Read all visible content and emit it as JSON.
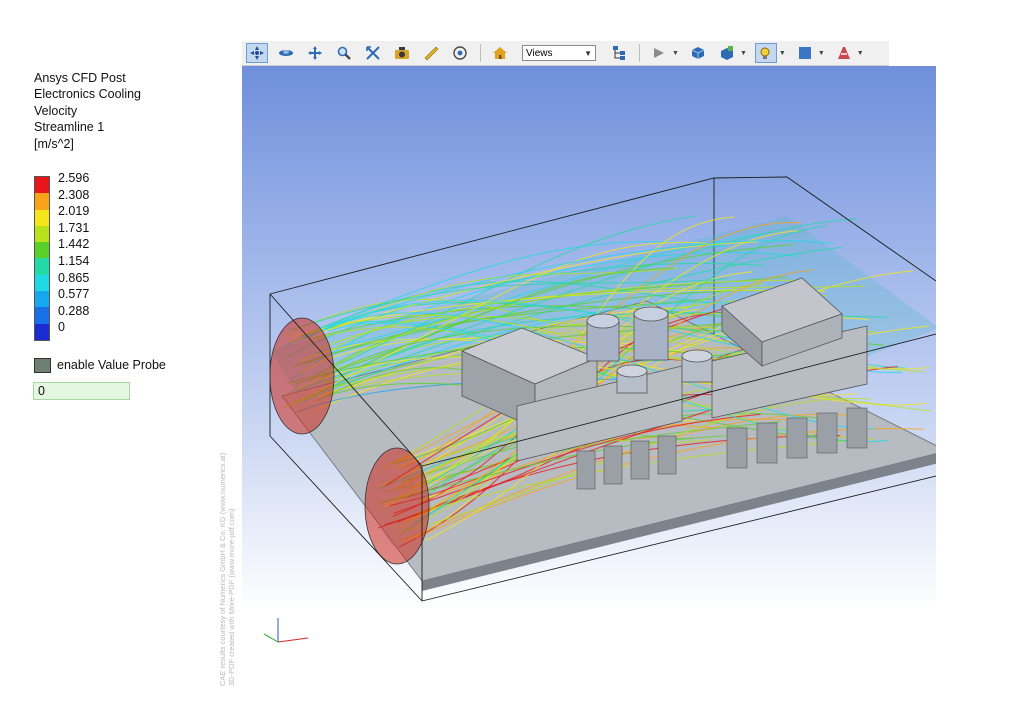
{
  "legend": {
    "app_title": "Ansys CFD Post",
    "case_name": "Electronics Cooling",
    "variable": "Velocity",
    "object_name": "Streamline 1",
    "units": "[m/s^2]",
    "ticks": [
      "2.596",
      "2.308",
      "2.019",
      "1.731",
      "1.442",
      "1.154",
      "0.865",
      "0.577",
      "0.288",
      "0"
    ],
    "colors": [
      "#e8161a",
      "#f9a31a",
      "#f5e61b",
      "#b7e21c",
      "#5ad129",
      "#23d9a5",
      "#1fd9e6",
      "#17a7ef",
      "#1870e6",
      "#1a2bd2"
    ]
  },
  "probe": {
    "label": "enable Value Probe",
    "value": "0"
  },
  "toolbar": {
    "buttons": [
      "select-icon",
      "rotate-icon",
      "pan-icon",
      "zoom-icon",
      "zoom-box-icon",
      "camera-icon",
      "measure-icon",
      "probe-icon",
      "home-icon",
      "views-select",
      "model-tree-icon",
      "play-icon",
      "solid-view-icon",
      "view-style-icon",
      "light-icon",
      "background-icon",
      "cross-section-icon"
    ],
    "views_label": "Views",
    "accent": "#3b76c4"
  },
  "viewport": {
    "background_top": "#6f8fdb",
    "background_bottom": "#ffffff"
  },
  "watermark": {
    "line1": "CAE results courtesy of Numerics GmbH & Co. KG (www.numerics.at)",
    "line2": "3D-PDF created with More-PDF (www.more-pdf.com)"
  }
}
